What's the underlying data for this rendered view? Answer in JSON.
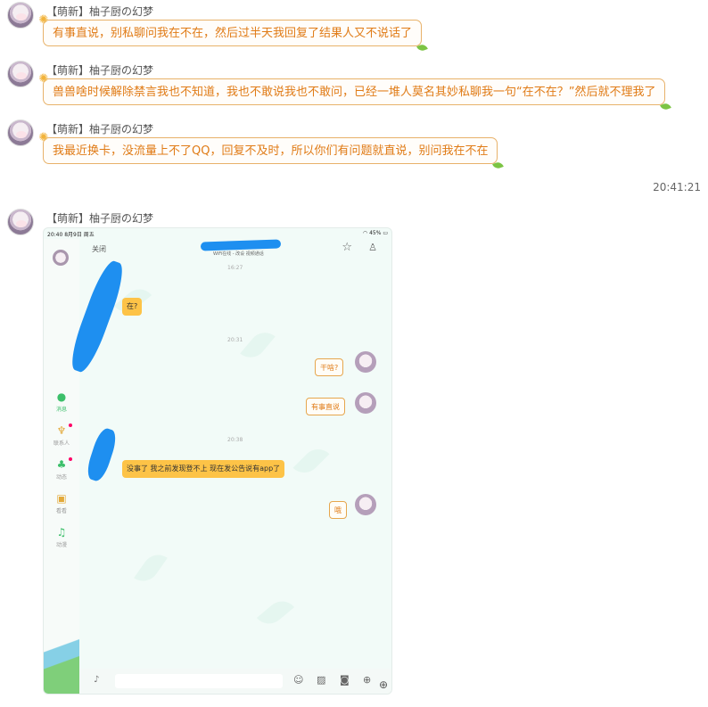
{
  "messages": [
    {
      "sender": "【萌新】柚子厨の幻梦",
      "text": "有事直说，别私聊问我在不在，然后过半天我回复了结果人又不说话了"
    },
    {
      "sender": "【萌新】柚子厨の幻梦",
      "text": "兽兽啥时候解除禁言我也不知道，我也不敢说我也不敢问，已经一堆人莫名其妙私聊我一句“在不在？”然后就不理我了"
    },
    {
      "sender": "【萌新】柚子厨の幻梦",
      "text": "我最近换卡，没流量上不了QQ，回复不及时，所以你们有问题就直说，别问我在不在"
    }
  ],
  "timestamp": "20:41:21",
  "image_message": {
    "sender": "【萌新】柚子厨の幻梦",
    "screenshot": {
      "status_time": "20:40  8月9日 周五",
      "status_battery": "45%",
      "close_label": "关闭",
      "subtitle": "WiFi在线 - 改设 视频通话",
      "nav": [
        "消息",
        "联系人",
        "动态",
        "看看",
        "动漫"
      ],
      "times": [
        "16:27",
        "20:31",
        "20:38"
      ],
      "chat": [
        {
          "dir": "in",
          "text": "在?"
        },
        {
          "dir": "out",
          "text": "干啥?"
        },
        {
          "dir": "out",
          "text": "有事直说"
        },
        {
          "dir": "in",
          "text": "没事了  我之前发现登不上   现在发公告说有app了"
        },
        {
          "dir": "out",
          "text": "哦"
        }
      ]
    }
  },
  "icons": [
    "sun-icon",
    "leaf-icon",
    "star-icon",
    "person-icon",
    "mic-icon",
    "emoji-icon",
    "image-icon",
    "camera-icon",
    "plus-icon"
  ],
  "colors": {
    "bubble_text": "#e07b16",
    "bubble_border": "#e8b26a",
    "incoming_bubble": "#fdc347",
    "scribble": "#1e8ff0"
  }
}
